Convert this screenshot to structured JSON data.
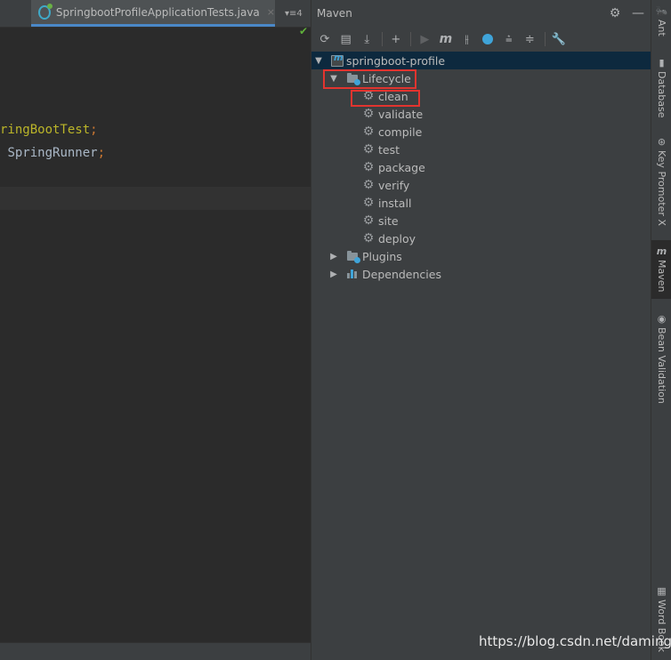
{
  "editor": {
    "tabs": [
      {
        "label": "va"
      },
      {
        "label": "SpringbootProfileApplicationTests.java",
        "close": "×"
      }
    ],
    "overflow_label": "▾≡4",
    "check_mark": "✔",
    "code": [
      {
        "yellow": "ringBootTest",
        "semi": ";"
      },
      {
        "text": "SpringRunner",
        "semi": ";"
      }
    ]
  },
  "maven": {
    "title": "Maven",
    "header_buttons": {
      "settings": "⚙",
      "minimize": "—"
    },
    "toolbar": {
      "reload": "⟳",
      "generate_sources": "▤",
      "download": "⤓",
      "add": "+",
      "run": "▶",
      "execute_goal": "m",
      "toggle_offline": "⫲",
      "show_dependencies": "",
      "expand_all": "⩮",
      "collapse_all": "≑",
      "settings": "🔧"
    },
    "tree": {
      "root": "springboot-profile",
      "lifecycle": "Lifecycle",
      "goals": [
        "clean",
        "validate",
        "compile",
        "test",
        "package",
        "verify",
        "install",
        "site",
        "deploy"
      ],
      "plugins": "Plugins",
      "dependencies": "Dependencies"
    }
  },
  "right_strip": [
    {
      "label": "Ant",
      "icon": "🐜"
    },
    {
      "label": "Database",
      "icon": "▮"
    },
    {
      "label": "Key Promoter X",
      "icon": "⊛"
    },
    {
      "label": "Maven",
      "icon": "m",
      "active": true
    },
    {
      "label": "Bean Validation",
      "icon": "◉"
    },
    {
      "label": "Word Book",
      "icon": "▦"
    }
  ],
  "watermark": "https://blog.csdn.net/damingl"
}
